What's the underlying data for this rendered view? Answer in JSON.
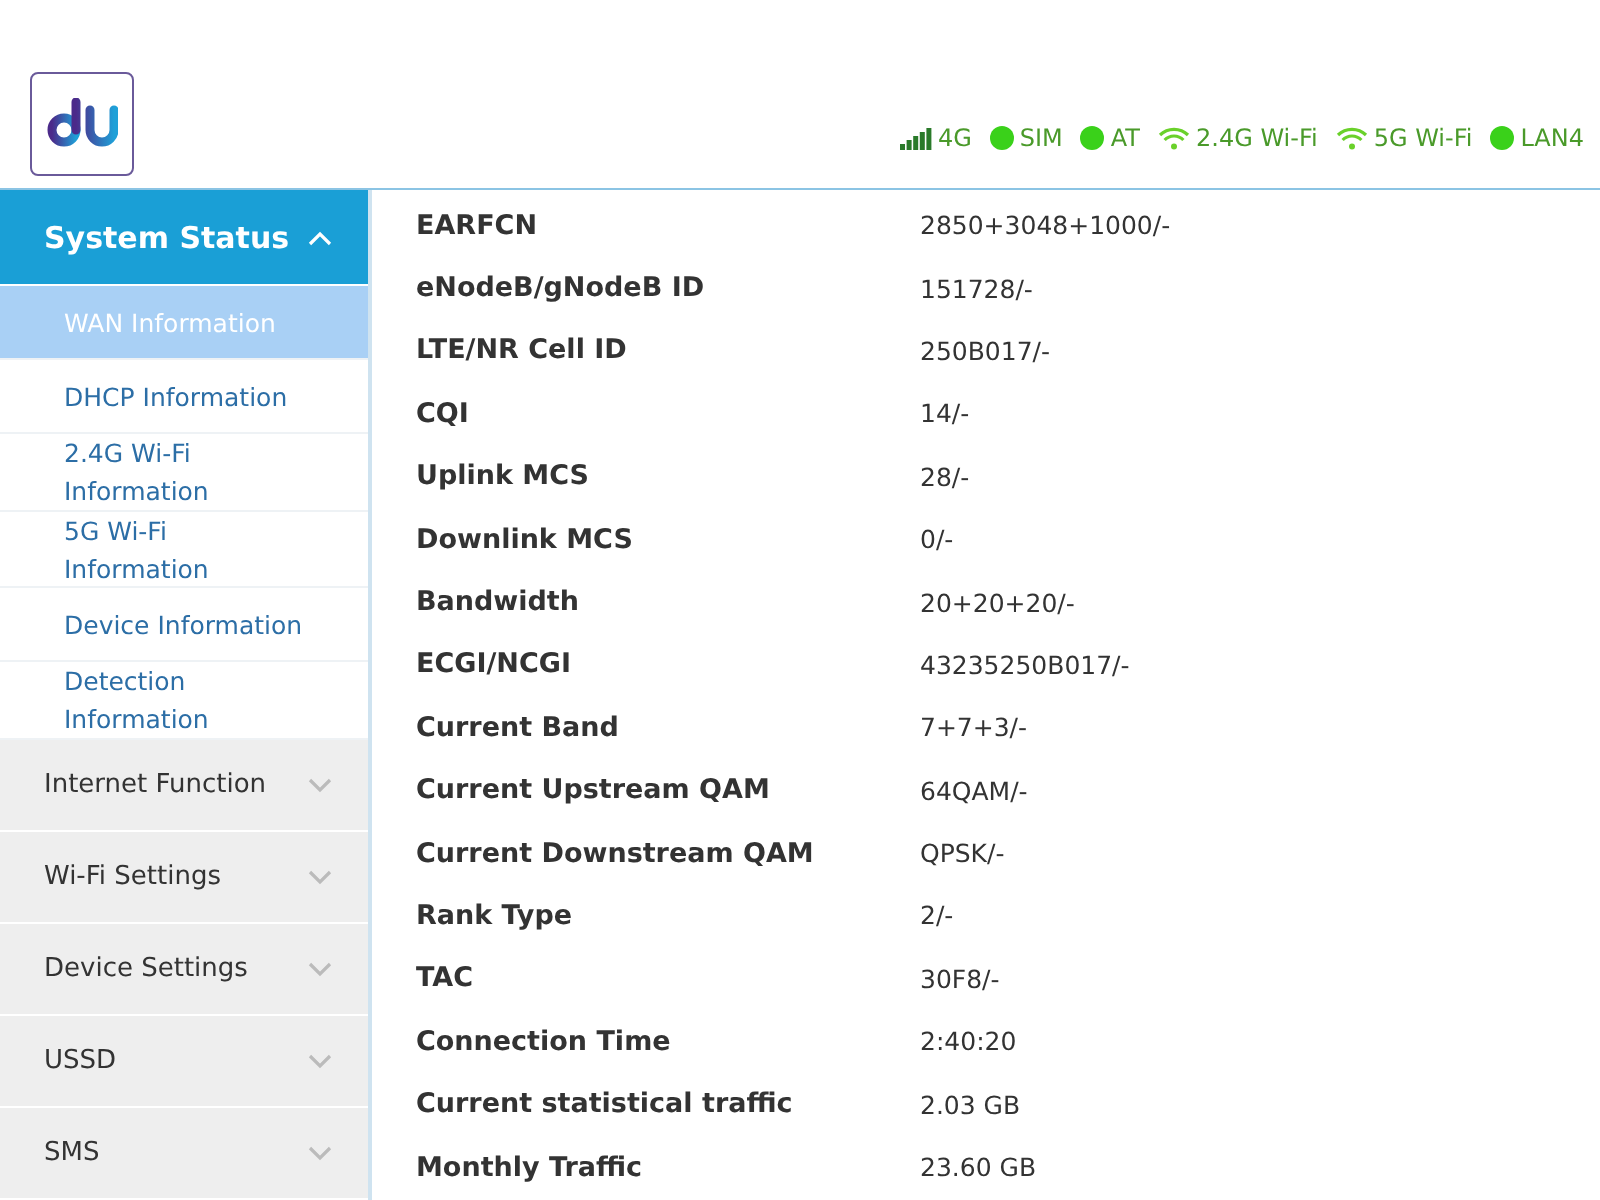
{
  "status_bar": [
    {
      "kind": "signal",
      "label": "4G"
    },
    {
      "kind": "dot",
      "label": "SIM"
    },
    {
      "kind": "dot",
      "label": "AT"
    },
    {
      "kind": "wifi",
      "label": "2.4G Wi-Fi"
    },
    {
      "kind": "wifi",
      "label": "5G Wi-Fi"
    },
    {
      "kind": "dot",
      "label": "LAN4"
    }
  ],
  "sidebar": {
    "groups": [
      {
        "label": "System Status",
        "expanded": true,
        "children": [
          {
            "label": "WAN Information",
            "selected": true
          },
          {
            "label": "DHCP Information",
            "selected": false
          },
          {
            "label": "2.4G Wi-Fi Information",
            "selected": false
          },
          {
            "label": "5G Wi-Fi Information",
            "selected": false
          },
          {
            "label": "Device Information",
            "selected": false
          },
          {
            "label": "Detection Information",
            "selected": false
          }
        ]
      },
      {
        "label": "Internet Function",
        "expanded": false
      },
      {
        "label": "Wi-Fi Settings",
        "expanded": false
      },
      {
        "label": "Device Settings",
        "expanded": false
      },
      {
        "label": "USSD",
        "expanded": false
      },
      {
        "label": "SMS",
        "expanded": false
      }
    ]
  },
  "table": {
    "rows": [
      {
        "label": "EARFCN",
        "value": "2850+3048+1000/-"
      },
      {
        "label": "eNodeB/gNodeB ID",
        "value": "151728/-"
      },
      {
        "label": "LTE/NR Cell ID",
        "value": "250B017/-"
      },
      {
        "label": "CQI",
        "value": "14/-"
      },
      {
        "label": "Uplink MCS",
        "value": "28/-"
      },
      {
        "label": "Downlink MCS",
        "value": "0/-"
      },
      {
        "label": "Bandwidth",
        "value": "20+20+20/-"
      },
      {
        "label": "ECGI/NCGI",
        "value": "43235250B017/-"
      },
      {
        "label": "Current Band",
        "value": "7+7+3/-"
      },
      {
        "label": "Current Upstream QAM",
        "value": "64QAM/-"
      },
      {
        "label": "Current Downstream QAM",
        "value": "QPSK/-"
      },
      {
        "label": "Rank Type",
        "value": "2/-"
      },
      {
        "label": "TAC",
        "value": "30F8/-"
      },
      {
        "label": "Connection Time",
        "value": "2:40:20"
      },
      {
        "label": "Current statistical traffic",
        "value": "2.03 GB"
      },
      {
        "label": "Monthly Traffic",
        "value": "23.60 GB"
      }
    ]
  }
}
